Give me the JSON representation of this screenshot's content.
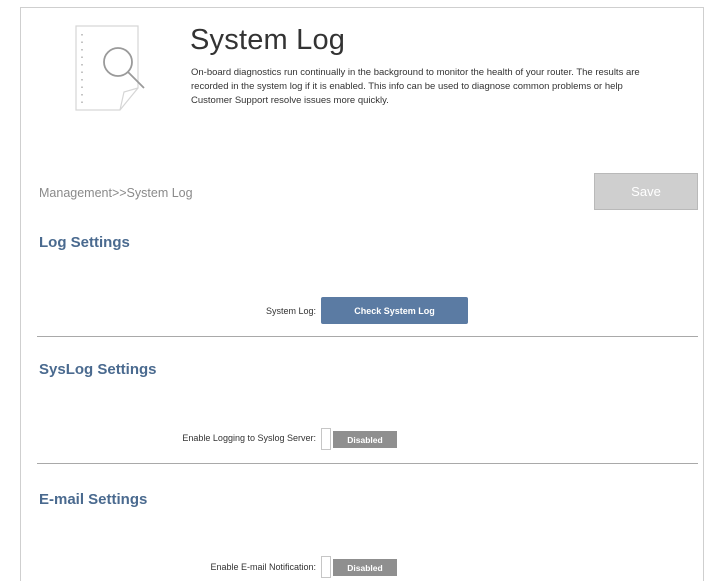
{
  "header": {
    "title": "System Log",
    "description": "On-board diagnostics run continually in the background to monitor the health of your router. The results are recorded in the system log if it is enabled. This info can be used to diagnose common problems or help Customer Support resolve issues more quickly.",
    "icon": "log-search-icon"
  },
  "breadcrumb": "Management>>System Log",
  "toolbar": {
    "save_label": "Save"
  },
  "log_settings": {
    "title": "Log Settings",
    "system_log_label": "System Log:",
    "check_button_label": "Check System Log"
  },
  "syslog_settings": {
    "title": "SysLog Settings",
    "enable_label": "Enable Logging to Syslog Server:",
    "toggle_state": "Disabled"
  },
  "email_settings": {
    "title": "E-mail Settings",
    "enable_label": "Enable E-mail Notification:",
    "toggle_state": "Disabled"
  },
  "colors": {
    "accent": "#4a6a8f",
    "button": "#5b7ba3",
    "toggle_off": "#8f8f8f",
    "save_disabled": "#cfcfcf"
  }
}
